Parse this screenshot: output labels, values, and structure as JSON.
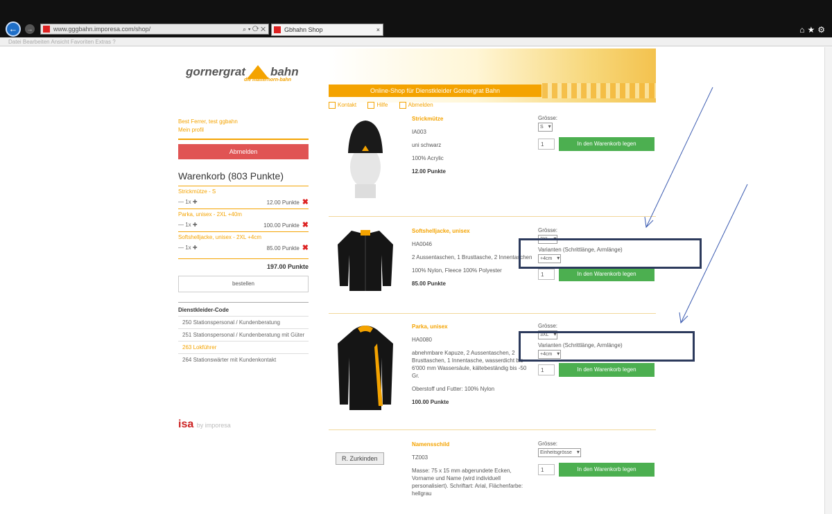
{
  "browser": {
    "url": "www.gggbahn.imporesa.com/shop/",
    "tab_title": "Gbhahn Shop",
    "menu": "Datei  Bearbeiten  Ansicht  Favoriten  Extras  ?"
  },
  "site": {
    "logo_text_left": "gornergrat",
    "logo_text_right": "bahn",
    "logo_sub": "die matterhorn-bahn",
    "banner_text": "Online-Shop für Dienstkleider Gornergrat Bahn",
    "nav": [
      "Kontakt",
      "Hilfe",
      "Abmelden"
    ]
  },
  "sidebar": {
    "user_line": "Best Ferrer, test ggbahn",
    "profile": "Mein profil",
    "logout": "Abmelden",
    "cart_title": "Warenkorb (803 Punkte)",
    "cart_items": [
      {
        "name": "Strickmütze - S",
        "qty": "1x",
        "points": "12.00 Punkte"
      },
      {
        "name": "Parka, unisex - 2XL +40m",
        "qty": "1x",
        "points": "100.00 Punkte"
      },
      {
        "name": "Softshelljacke, unisex - 2XL +4cm",
        "qty": "1x",
        "points": "85.00 Punkte"
      }
    ],
    "total": "197.00 Punkte",
    "order_button": "bestellen",
    "code_title": "Dienstkleider-Code",
    "codes": [
      "250 Stationspersonal / Kundenberatung",
      "251 Stationspersonal / Kundenberatung mit Güter",
      "263 Lokführer",
      "264 Stationswärter mit Kundenkontakt"
    ],
    "active_code_index": 2,
    "footer_logo": "isa",
    "footer_sub": "by imporesa"
  },
  "products": [
    {
      "name": "Strickmütze",
      "sku": "IA003",
      "line2": "uni schwarz",
      "material": "100% Acrylic",
      "price": "12.00 Punkte",
      "size_label": "Grösse:",
      "size_value": "S",
      "qty": "1",
      "add_label": "In den Warenkorb legen"
    },
    {
      "name": "Softshelljacke, unisex",
      "sku": "HA0046",
      "line2": "2 Aussentaschen, 1 Brusttasche, 2 Innentaschen",
      "material": "100% Nylon, Fleece 100% Polyester",
      "price": "85.00 Punkte",
      "size_label": "Grösse:",
      "size_value": "2XL",
      "variant_label": "Varianten (Schrittlänge, Armlänge)",
      "variant_value": "+4cm",
      "qty": "1",
      "add_label": "In den Warenkorb legen"
    },
    {
      "name": "Parka, unisex",
      "sku": "HA0080",
      "line2": "abnehmbare Kapuze, 2 Aussentaschen, 2 Brusttaschen, 1 Innentasche, wasserdicht bis 6'000 mm Wassersäule, kältebeständig bis -50 Gr.",
      "material": "Oberstoff und Futter: 100% Nylon",
      "price": "100.00 Punkte",
      "size_label": "Grösse:",
      "size_value": "3XL",
      "variant_label": "Varianten (Schrittlänge, Armlänge)",
      "variant_value": "+4cm",
      "qty": "1",
      "add_label": "In den Warenkorb legen"
    },
    {
      "name": "Namensschild",
      "sku": "TZ003",
      "line2": "Masse: 75 x 15 mm abgerundete Ecken, Vorname und Name (wird individuell personalisiert). Schriftart: Arial, Flächenfarbe: hellgrau",
      "material": "",
      "price": "",
      "size_label": "Grösse:",
      "size_value": "Einheitsgrösse",
      "qty": "1",
      "add_label": "In den Warenkorb legen",
      "chip_label": "R. Zurkinden"
    }
  ]
}
